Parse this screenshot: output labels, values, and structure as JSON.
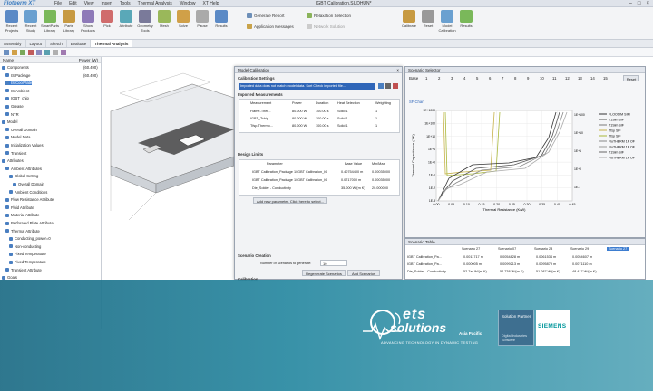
{
  "titlebar": {
    "logo": "Flotherm XT",
    "menu": [
      "File",
      "Edit",
      "View",
      "Insert",
      "Tools",
      "Thermal Analysis",
      "Window",
      "XT Help"
    ],
    "document": "IGBT Calibration.SUDHUN*",
    "controls": [
      "–",
      "□",
      "×"
    ]
  },
  "ribbon": {
    "buttons": [
      {
        "label": "Recent Projects"
      },
      {
        "label": "Recent Study"
      },
      {
        "label": "SmartParts Library"
      },
      {
        "label": "Parts Library"
      },
      {
        "label": "Show Products"
      },
      {
        "label": "Pick"
      },
      {
        "label": "Attribute"
      },
      {
        "label": "Geometry Tools"
      },
      {
        "label": "Mesh"
      },
      {
        "label": "Solve"
      },
      {
        "label": "Pause"
      },
      {
        "label": "Results"
      },
      {
        "label": "Calibrate"
      },
      {
        "label": "Reset"
      },
      {
        "label": "Model Calibration"
      },
      {
        "label": "Results"
      }
    ],
    "generate_report": "Generate Report",
    "application_messages": "Application Messages",
    "relaxation_selection": "Relaxation Selection",
    "network_solution": "Network Solution"
  },
  "tabs": [
    "Assembly",
    "Layout",
    "Sketch",
    "Evaluate",
    "Thermal Analysis"
  ],
  "tree": {
    "col_name": "Name",
    "col_power": "Power (W)",
    "items": [
      {
        "label": "Components",
        "value": "(60.490)"
      },
      {
        "label": "IS Package",
        "value": "(60.490)"
      },
      {
        "label": "IS CoolPlate",
        "value": ""
      },
      {
        "label": "IS Ambient",
        "value": ""
      },
      {
        "label": "IGBT_chip",
        "value": ""
      },
      {
        "label": "Grease",
        "value": ""
      },
      {
        "label": "NTR",
        "value": ""
      },
      {
        "label": "Model",
        "value": ""
      },
      {
        "label": "Overall Domain",
        "value": ""
      },
      {
        "label": "Model Data",
        "value": ""
      },
      {
        "label": "Initialization Values",
        "value": ""
      },
      {
        "label": "Transient",
        "value": ""
      },
      {
        "label": "Attributes",
        "value": ""
      },
      {
        "label": "Ambient Attributes",
        "value": ""
      },
      {
        "label": "Global Setting",
        "value": ""
      },
      {
        "label": "Overall Domain",
        "value": ""
      },
      {
        "label": "Ambient Conditions",
        "value": ""
      },
      {
        "label": "Flow Resistance Attribute",
        "value": ""
      },
      {
        "label": "Fluid Attribute",
        "value": ""
      },
      {
        "label": "Material Attribute",
        "value": ""
      },
      {
        "label": "Perforated Plate Attribute",
        "value": ""
      },
      {
        "label": "Thermal Attribute",
        "value": ""
      },
      {
        "label": "Conducting_power=0",
        "value": ""
      },
      {
        "label": "Non-conducting",
        "value": ""
      },
      {
        "label": "Fixed Temperature",
        "value": ""
      },
      {
        "label": "Fixed Temperature",
        "value": ""
      },
      {
        "label": "Transient Attribute",
        "value": ""
      },
      {
        "label": "Goals",
        "value": ""
      }
    ]
  },
  "dialog": {
    "title": "Model Calibration",
    "settings_label": "Calibration Settings",
    "info_text": "Imported data does not match model data. Sort Check imported file...",
    "measurements_label": "Imported Measurements",
    "meas_headers": [
      "Measurement",
      "Power",
      "Duration",
      "Heat Selection",
      "Weighting"
    ],
    "measurements": [
      {
        "name": "Flame-Ther...",
        "power": "80.000 W",
        "duration": "100.00 s",
        "heat": "Solid 1",
        "w": "1"
      },
      {
        "name": "IGBT_Tchip...",
        "power": "80.000 W",
        "duration": "100.00 s",
        "heat": "Solid 1",
        "w": "1"
      },
      {
        "name": "Tfsp-Thermo...",
        "power": "80.000 W",
        "duration": "100.00 s",
        "heat": "Solid 1",
        "w": "1"
      }
    ],
    "limits_label": "Design Limits",
    "limit_headers": [
      "Parameter",
      "Base Value",
      "Min/Max"
    ],
    "limits": [
      {
        "name": "IGBT Calibration_Package 1/IGBT Calibration_IG",
        "base": "0.40754400 m",
        "range": "0.00035000"
      },
      {
        "name": "IGBT Calibration_Package 1/IGBT Calibration_IG",
        "base": "0.0717000 m",
        "range": "0.00035000"
      },
      {
        "name": "Die_Solder - Conductivity",
        "base": "35.000 W/(m K)",
        "range": "20.000000"
      }
    ],
    "add_limit": "Add new parameter. Click here to select...",
    "creation_label": "Scenario Creation",
    "num_scenarios_label": "Number of scenarios to generate:",
    "num_scenarios": "10",
    "regen_button": "Regenerate Scenarios",
    "add_button": "Add Scenarios",
    "calibration_label": "Calibration"
  },
  "scenario": {
    "title": "Scenario Selector",
    "base_label": "Base",
    "numbers": [
      "1",
      "2",
      "3",
      "4",
      "5",
      "6",
      "7",
      "8",
      "9",
      "10",
      "11",
      "12",
      "13",
      "14",
      "15"
    ],
    "reset": "Reset",
    "chart_tab": "SF Chart",
    "xlabel": "Thermal Resistance (K/W)",
    "ylabel": "Thermal Capacitance (J/K)",
    "x_ticks": [
      "0.00",
      "0.05",
      "0.10",
      "0.15",
      "0.20",
      "0.25",
      "0.30",
      "0.35",
      "0.40",
      "0.45"
    ],
    "y_ticks": [
      "1E+1000",
      "1E+100",
      "1E+10",
      "1E+1",
      "1E+0",
      "1E-1",
      "1E-2",
      "1E-3"
    ],
    "legend": [
      {
        "name": "FLOOSIM SIM",
        "color": "#333333"
      },
      {
        "name": "T1Sim SIF",
        "color": "#555555"
      },
      {
        "name": "T1Sim SIF",
        "color": "#7a7a7a"
      },
      {
        "name": "Tfsp SIF",
        "color": "#c7b24a"
      },
      {
        "name": "Tfsp SIF",
        "color": "#a9b83a"
      },
      {
        "name": "FluTHERM 1F OF",
        "color": "#888888"
      },
      {
        "name": "FluTHERM 1F OF",
        "color": "#999999"
      },
      {
        "name": "T1Sim SIF",
        "color": "#666666"
      },
      {
        "name": "FluTHERM 1F OF",
        "color": "#aaaaaa"
      }
    ]
  },
  "table": {
    "title": "Scenario Table",
    "headers": [
      "Scenario 27",
      "Scenario 07",
      "Scenario 28",
      "Scenario 29",
      "Scenario 27"
    ],
    "rows": [
      [
        "IGBT Calibration_Pa...",
        "0.0011717 m",
        "0.0054828 m",
        "0.0061534 m",
        "0.0054607 m"
      ],
      [
        "IGBT Calibration_Pa...",
        "0.000005 m",
        "0.0099213 m",
        "0.0095879 m",
        "0.0071110 m"
      ],
      [
        "Die_Solder - Conductivity",
        "52.7ar W/(m K)",
        "52.738 W/(m K)",
        "51.087 W/(m K)",
        "48.417 W/(m K)"
      ]
    ]
  },
  "branding": {
    "ets_line1": "ets",
    "ets_line2": "solutions",
    "region": "Asia Pacific",
    "tagline": "ADVANCING TECHNOLOGY IN DYNAMIC TESTING",
    "partner_title": "Solution Partner",
    "partner_sub": "Digital Industries Software",
    "siemens": "SIEMENS"
  },
  "colors": {
    "overlay": "#2a8aa2",
    "accent": "#3a7bbf",
    "siemens": "#00969b"
  }
}
